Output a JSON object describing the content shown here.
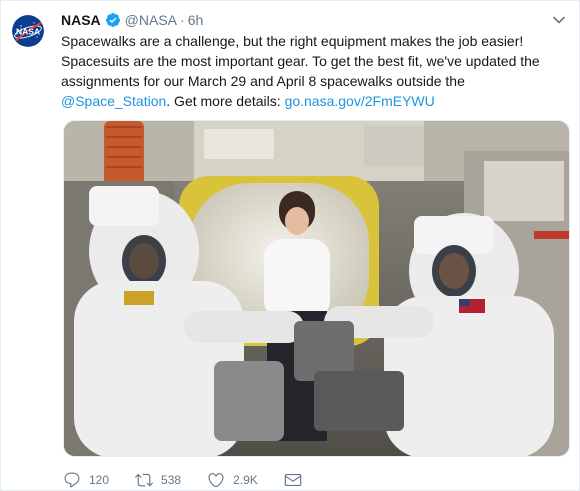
{
  "tweet": {
    "author_name": "NASA",
    "handle": "@NASA",
    "separator": "·",
    "time": "6h",
    "avatar_alt_text": "NASA",
    "text_line1": "Spacewalks are a challenge, but the right equipment makes the job easier!",
    "text_line2": "Spacesuits are the most important gear. To get the best fit, we've updated the",
    "text_line3": "assignments for our March 29 and April 8 spacewalks outside the",
    "mention": "@Space_Station",
    "text_line4_mid": ". Get more details: ",
    "url": "go.nasa.gov/2FmEYWU"
  },
  "actions": {
    "reply_count": "120",
    "retweet_count": "538",
    "like_count": "2.9K"
  },
  "icons": {
    "verified": "verified-badge-icon",
    "caret": "chevron-down-icon",
    "reply": "reply-icon",
    "retweet": "retweet-icon",
    "like": "heart-icon",
    "dm": "envelope-icon"
  },
  "colors": {
    "link": "#1b95e0",
    "verified": "#1da1f2",
    "secondary_text": "#657786",
    "nasa_blue": "#0b3d91",
    "nasa_red": "#fc3d21"
  }
}
